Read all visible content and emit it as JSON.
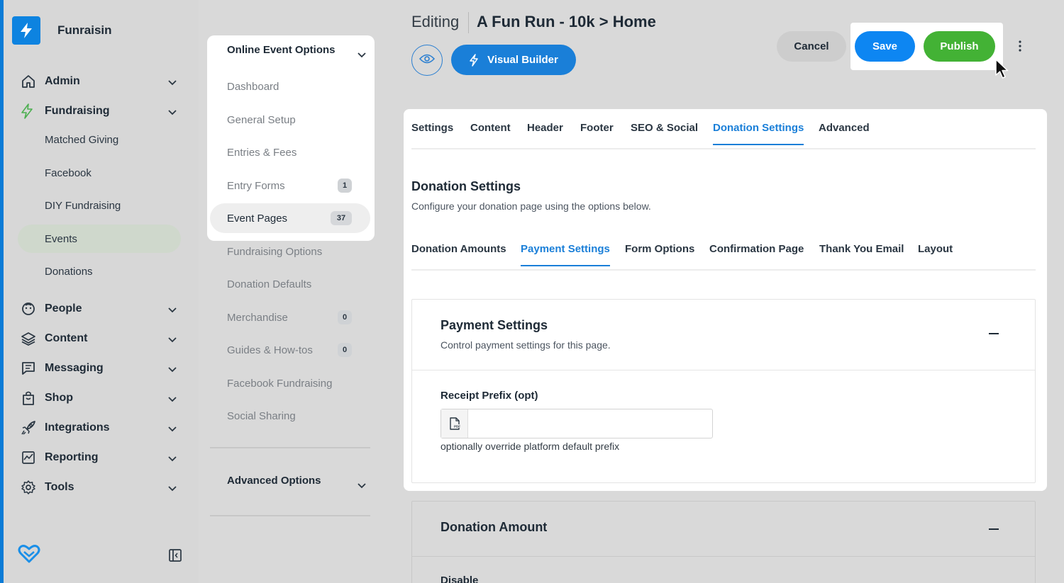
{
  "brand": {
    "name": "Funraisin"
  },
  "nav": {
    "items": [
      {
        "label": "Admin",
        "icon": "home-icon"
      },
      {
        "label": "Fundraising",
        "icon": "bolt-icon"
      },
      {
        "label": "People",
        "icon": "face-icon"
      },
      {
        "label": "Content",
        "icon": "layers-icon"
      },
      {
        "label": "Messaging",
        "icon": "message-icon"
      },
      {
        "label": "Shop",
        "icon": "bag-icon"
      },
      {
        "label": "Integrations",
        "icon": "rocket-icon"
      },
      {
        "label": "Reporting",
        "icon": "chart-icon"
      },
      {
        "label": "Tools",
        "icon": "gear-icon"
      }
    ],
    "fundraising_sub": [
      "Matched Giving",
      "Facebook",
      "DIY Fundraising",
      "Events",
      "Donations"
    ],
    "active_sub": "Events"
  },
  "subpanel": {
    "heading": "Online Event Options",
    "items": [
      {
        "label": "Dashboard",
        "badge": ""
      },
      {
        "label": "General Setup",
        "badge": ""
      },
      {
        "label": "Entries & Fees",
        "badge": ""
      },
      {
        "label": "Entry Forms",
        "badge": "1"
      },
      {
        "label": "Event Pages",
        "badge": "37"
      },
      {
        "label": "Fundraising Options",
        "badge": ""
      },
      {
        "label": "Donation Defaults",
        "badge": ""
      },
      {
        "label": "Merchandise",
        "badge": "0"
      },
      {
        "label": "Guides & How-tos",
        "badge": "0"
      },
      {
        "label": "Facebook Fundraising",
        "badge": ""
      },
      {
        "label": "Social Sharing",
        "badge": ""
      }
    ],
    "advanced": "Advanced Options"
  },
  "header": {
    "editing": "Editing",
    "title": "A Fun Run - 10k > Home",
    "visual_builder": "Visual Builder",
    "cancel": "Cancel",
    "save": "Save",
    "publish": "Publish"
  },
  "tabs": [
    "Settings",
    "Content",
    "Header",
    "Footer",
    "SEO & Social",
    "Donation Settings",
    "Advanced"
  ],
  "active_tab": "Donation Settings",
  "section": {
    "title": "Donation Settings",
    "desc": "Configure your donation page using the options below."
  },
  "subtabs": [
    "Donation Amounts",
    "Payment Settings",
    "Form Options",
    "Confirmation Page",
    "Thank You Email",
    "Layout"
  ],
  "active_subtab": "Payment Settings",
  "payment": {
    "title": "Payment Settings",
    "desc": "Control payment settings for this page.",
    "receipt_label": "Receipt Prefix (opt)",
    "receipt_value": "",
    "receipt_help": "optionally override platform default prefix"
  },
  "donation_amount": {
    "title": "Donation Amount",
    "first_label": "Disable"
  },
  "colors": {
    "accent": "#0a7bd6",
    "save": "#0d86f2",
    "publish": "#43b235",
    "active_tab": "#1a7fd8"
  }
}
